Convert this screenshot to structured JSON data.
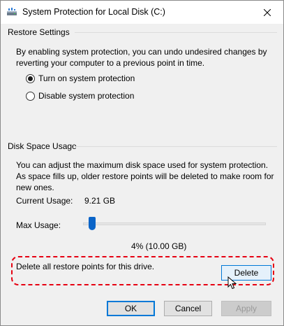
{
  "window": {
    "title": "System Protection for Local Disk (C:)"
  },
  "restore_settings": {
    "label": "Restore Settings",
    "description": "By enabling system protection, you can undo undesired changes by reverting your computer to a previous point in time.",
    "options": [
      {
        "label": "Turn on system protection",
        "selected": true
      },
      {
        "label": "Disable system protection",
        "selected": false
      }
    ]
  },
  "disk_space": {
    "label": "Disk Space Usage",
    "description": "You can adjust the maximum disk space used for system protection. As space fills up, older restore points will be deleted to make room for new ones.",
    "current_usage_label": "Current Usage:",
    "current_usage_value": "9.21 GB",
    "max_usage_label": "Max Usage:",
    "max_usage_percent": 4,
    "max_usage_readout": "4% (10.00 GB)"
  },
  "delete_section": {
    "text": "Delete all restore points for this drive.",
    "button": "Delete",
    "highlight_color": "#e60012"
  },
  "footer": {
    "ok": "OK",
    "cancel": "Cancel",
    "apply": "Apply"
  },
  "icons": {
    "title": "drive-protection-icon",
    "close": "close-icon",
    "cursor": "mouse-pointer-icon"
  }
}
